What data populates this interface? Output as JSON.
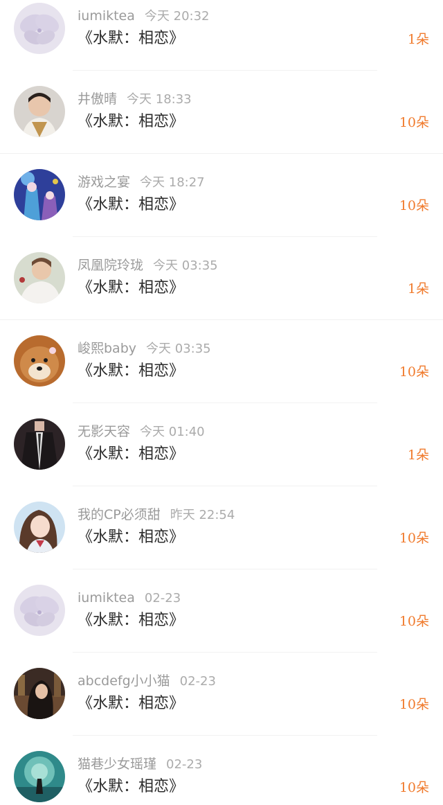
{
  "items": [
    {
      "user": "iumiktea",
      "time": "今天 20:32",
      "title": "《水默：相恋》",
      "count": "1朵"
    },
    {
      "user": "井傲晴",
      "time": "今天 18:33",
      "title": "《水默：相恋》",
      "count": "10朵"
    },
    {
      "user": "游戏之宴",
      "time": "今天 18:27",
      "title": "《水默：相恋》",
      "count": "10朵"
    },
    {
      "user": "凤凰院玲珑",
      "time": "今天 03:35",
      "title": "《水默：相恋》",
      "count": "1朵"
    },
    {
      "user": "峻熙baby",
      "time": "今天 03:35",
      "title": "《水默：相恋》",
      "count": "10朵"
    },
    {
      "user": "无影天容",
      "time": "今天 01:40",
      "title": "《水默：相恋》",
      "count": "1朵"
    },
    {
      "user": "我的CP必须甜",
      "time": "昨天 22:54",
      "title": "《水默：相恋》",
      "count": "10朵"
    },
    {
      "user": "iumiktea",
      "time": "02-23",
      "title": "《水默：相恋》",
      "count": "10朵"
    },
    {
      "user": "abcdefg小小猫",
      "time": "02-23",
      "title": "《水默：相恋》",
      "count": "10朵"
    },
    {
      "user": "猫巷少女瑶瑾",
      "time": "02-23",
      "title": "《水默：相恋》",
      "count": "10朵"
    }
  ],
  "colors": {
    "accent": "#f07a2c",
    "username": "#9a9a9a",
    "title": "#2b2b2b"
  }
}
